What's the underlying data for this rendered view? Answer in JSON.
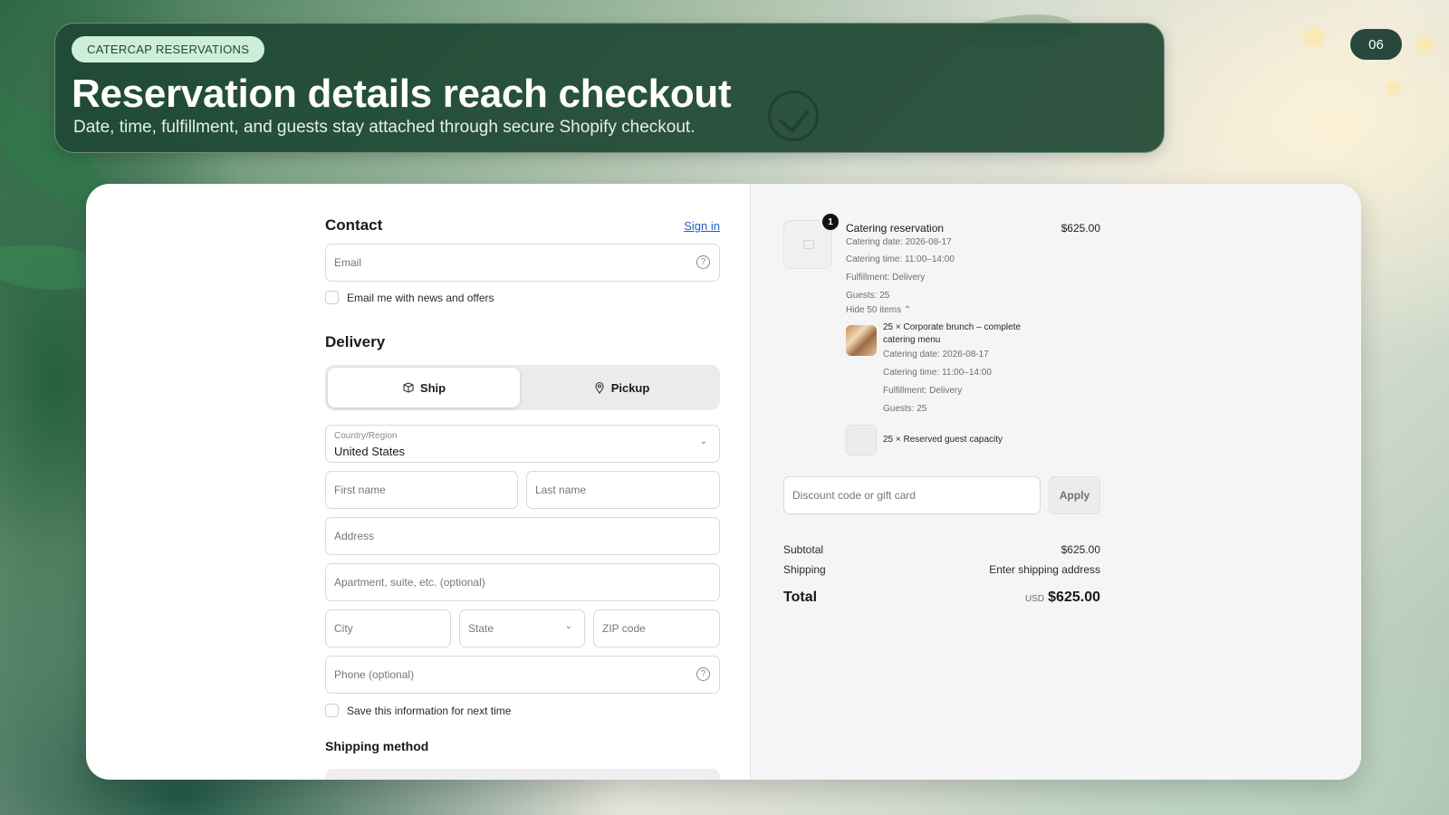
{
  "slide": {
    "number": "06",
    "badge": "CATERCAP RESERVATIONS",
    "title": "Reservation details reach checkout",
    "subtitle": "Date, time, fulfillment, and guests stay attached through secure Shopify checkout."
  },
  "colors": {
    "header_bg": "#1e4834",
    "badge_bg": "#cfeeda",
    "link": "#1c5fc9",
    "summary_bg": "#f5f5f5"
  },
  "checkout": {
    "contact": {
      "heading": "Contact",
      "sign_in": "Sign in",
      "email_placeholder": "Email",
      "news_label": "Email me with news and offers"
    },
    "delivery": {
      "heading": "Delivery",
      "tabs": [
        {
          "label": "Ship",
          "icon": "box-icon",
          "selected": true
        },
        {
          "label": "Pickup",
          "icon": "location-pin-icon",
          "selected": false
        }
      ],
      "country_label": "Country/Region",
      "country_value": "United States",
      "first_name": "First name",
      "last_name": "Last name",
      "address": "Address",
      "apartment": "Apartment, suite, etc. (optional)",
      "city": "City",
      "state": "State",
      "zip": "ZIP code",
      "phone": "Phone (optional)",
      "save_label": "Save this information for next time"
    },
    "shipping_method": {
      "heading": "Shipping method"
    }
  },
  "summary": {
    "item": {
      "qty": "1",
      "name": "Catering reservation",
      "price": "$625.00",
      "meta": [
        "Catering date: 2026-08-17",
        "Catering time: 11:00–14:00",
        "Fulfillment: Delivery",
        "Guests: 25"
      ],
      "toggle": "Hide 50 items"
    },
    "sub_items": [
      {
        "name": "25 × Corporate brunch – complete catering menu",
        "meta": [
          "Catering date: 2026-08-17",
          "Catering time: 11:00–14:00",
          "Fulfillment: Delivery",
          "Guests: 25"
        ]
      },
      {
        "name": "25 × Reserved guest capacity",
        "meta": []
      }
    ],
    "discount_placeholder": "Discount code or gift card",
    "apply_label": "Apply",
    "subtotal_label": "Subtotal",
    "subtotal_value": "$625.00",
    "shipping_label": "Shipping",
    "shipping_value": "Enter shipping address",
    "total_label": "Total",
    "total_currency": "USD",
    "total_value": "$625.00"
  }
}
